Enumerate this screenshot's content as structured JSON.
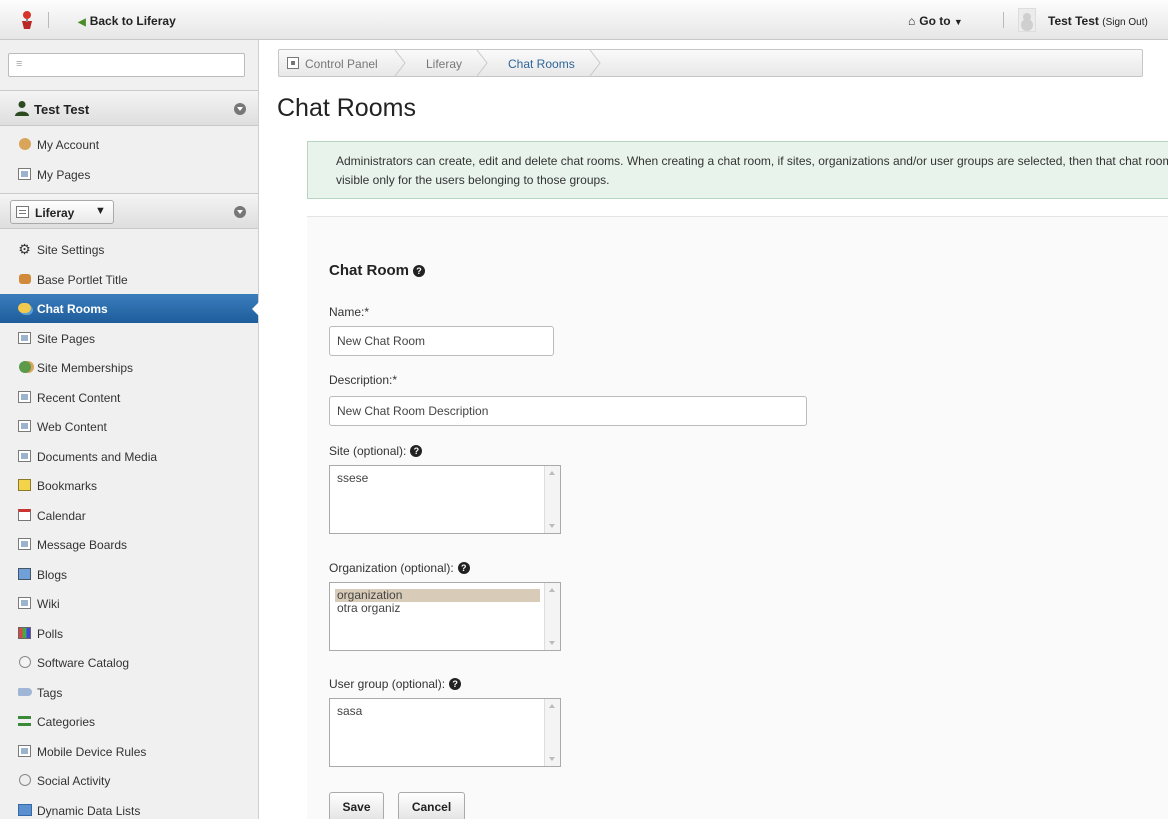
{
  "dockbar": {
    "back_label": "Back to Liferay",
    "goto_label": "Go to",
    "user_name": "Test Test",
    "sign_out": "(Sign Out)"
  },
  "sidebar": {
    "user_panel_title": "Test Test",
    "user_items": [
      {
        "label": "My Account",
        "icon": "my-account-icon"
      },
      {
        "label": "My Pages",
        "icon": "my-pages-icon"
      }
    ],
    "site_selector": "Liferay",
    "site_items": [
      {
        "label": "Site Settings",
        "icon": "gear-icon"
      },
      {
        "label": "Base Portlet Title",
        "icon": "portlet-icon"
      },
      {
        "label": "Chat Rooms",
        "icon": "chat-rooms-icon",
        "active": true
      },
      {
        "label": "Site Pages",
        "icon": "site-pages-icon"
      },
      {
        "label": "Site Memberships",
        "icon": "site-memberships-icon"
      },
      {
        "label": "Recent Content",
        "icon": "recent-content-icon"
      },
      {
        "label": "Web Content",
        "icon": "web-content-icon"
      },
      {
        "label": "Documents and Media",
        "icon": "documents-icon"
      },
      {
        "label": "Bookmarks",
        "icon": "bookmarks-icon"
      },
      {
        "label": "Calendar",
        "icon": "calendar-icon"
      },
      {
        "label": "Message Boards",
        "icon": "message-boards-icon"
      },
      {
        "label": "Blogs",
        "icon": "blogs-icon"
      },
      {
        "label": "Wiki",
        "icon": "wiki-icon"
      },
      {
        "label": "Polls",
        "icon": "polls-icon"
      },
      {
        "label": "Software Catalog",
        "icon": "software-catalog-icon"
      },
      {
        "label": "Tags",
        "icon": "tags-icon"
      },
      {
        "label": "Categories",
        "icon": "categories-icon"
      },
      {
        "label": "Mobile Device Rules",
        "icon": "mobile-rules-icon"
      },
      {
        "label": "Social Activity",
        "icon": "social-activity-icon"
      },
      {
        "label": "Dynamic Data Lists",
        "icon": "ddl-icon"
      }
    ]
  },
  "breadcrumb": [
    "Control Panel",
    "Liferay",
    "Chat Rooms"
  ],
  "page_title": "Chat Rooms",
  "info_text": "Administrators can create, edit and delete chat rooms. When creating a chat room, if sites, organizations and/or user groups are selected, then that chat room will be visible only for the users belonging to those groups.",
  "form": {
    "section_title": "Chat Room",
    "name_label": "Name:*",
    "name_value": "New Chat Room",
    "description_label": "Description:*",
    "description_value": "New Chat Room Description",
    "site_label": "Site (optional):",
    "site_options": [
      "ssese"
    ],
    "organization_label": "Organization (optional):",
    "organization_options": [
      "organization",
      "otra organiz"
    ],
    "organization_selected": "organization",
    "user_group_label": "User group (optional):",
    "user_group_options": [
      "sasa"
    ],
    "save_label": "Save",
    "cancel_label": "Cancel"
  },
  "colors": {
    "active_nav": "#2b6cab",
    "info_background": "#e8f3ec",
    "breadcrumb_current": "#2f6699"
  }
}
